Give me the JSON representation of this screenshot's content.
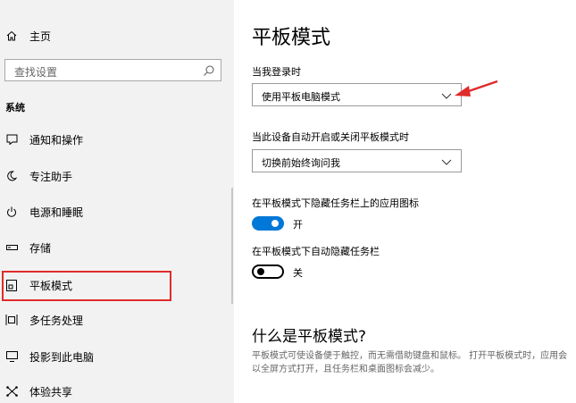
{
  "sidebar": {
    "home_label": "主页",
    "search_placeholder": "查找设置",
    "section_title": "系统",
    "items": [
      {
        "label": "通知和操作",
        "icon": "notification-icon"
      },
      {
        "label": "专注助手",
        "icon": "moon-icon"
      },
      {
        "label": "电源和睡眠",
        "icon": "power-icon"
      },
      {
        "label": "存储",
        "icon": "storage-icon"
      },
      {
        "label": "平板模式",
        "icon": "tablet-icon",
        "highlighted": true
      },
      {
        "label": "多任务处理",
        "icon": "multitasking-icon"
      },
      {
        "label": "投影到此电脑",
        "icon": "project-icon"
      },
      {
        "label": "体验共享",
        "icon": "share-experience-icon"
      }
    ]
  },
  "main": {
    "title": "平板模式",
    "login_label": "当我登录时",
    "login_value": "使用平板电脑模式",
    "auto_switch_label": "当此设备自动开启或关闭平板模式时",
    "auto_switch_value": "切换前始终询问我",
    "hide_icons_label": "在平板模式下隐藏任务栏上的应用图标",
    "hide_icons_state": "开",
    "hide_icons_on": true,
    "auto_hide_label": "在平板模式下自动隐藏任务栏",
    "auto_hide_state": "关",
    "auto_hide_on": false,
    "what_is_title": "什么是平板模式?",
    "what_is_desc": "平板模式可使设备便于触控，而无需借助键盘和鼠标。 打开平板模式时，应用会以全屏方式打开，且任务栏和桌面图标会减少。"
  },
  "colors": {
    "accent": "#0078d7",
    "highlight_box": "#e02b2b",
    "annotation_arrow": "#e02b2b"
  }
}
